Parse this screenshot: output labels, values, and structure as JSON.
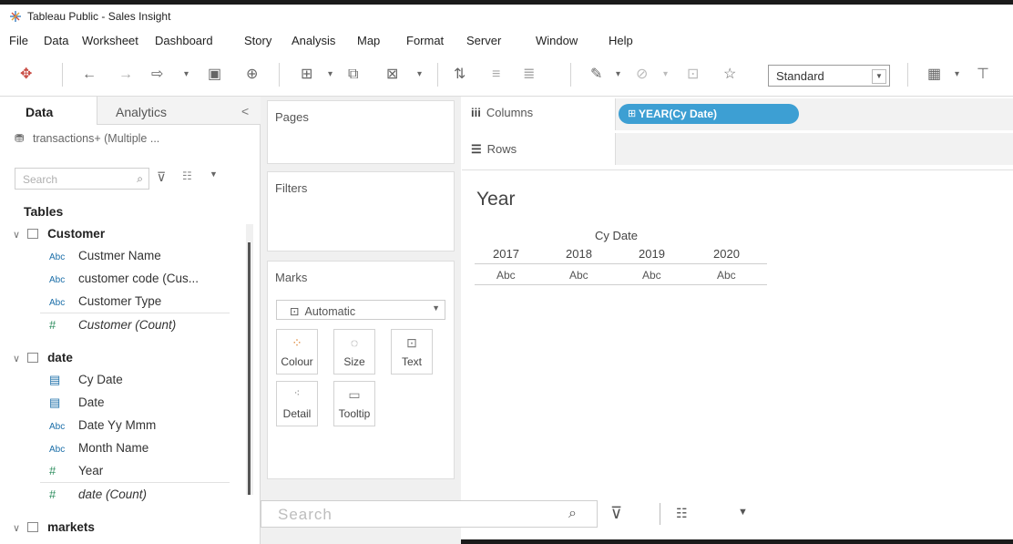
{
  "window": {
    "title": "Tableau Public - Sales Insight",
    "app_icon": "tableau-logo-icon"
  },
  "menu": [
    "File",
    "Data",
    "Worksheet",
    "Dashboard",
    "Story",
    "Analysis",
    "Map",
    "Format",
    "Server",
    "Window",
    "Help"
  ],
  "toolbar": {
    "fit_select": "Standard"
  },
  "data_pane": {
    "tab_data": "Data",
    "tab_analytics": "Analytics",
    "collapse": "<",
    "datasource": "transactions+ (Multiple ...",
    "search_placeholder": "Search",
    "tables_heading": "Tables",
    "groups": [
      {
        "name": "Customer",
        "fields": [
          {
            "type": "Abc",
            "name": "Custmer Name"
          },
          {
            "type": "Abc",
            "name": "customer code (Cus..."
          },
          {
            "type": "Abc",
            "name": "Customer Type"
          },
          {
            "type": "#",
            "name": "Customer (Count)",
            "italic": true
          }
        ]
      },
      {
        "name": "date",
        "fields": [
          {
            "type": "cal",
            "name": "Cy Date"
          },
          {
            "type": "cal",
            "name": "Date"
          },
          {
            "type": "Abc",
            "name": "Date Yy Mmm"
          },
          {
            "type": "Abc",
            "name": "Month Name"
          },
          {
            "type": "#",
            "name": "Year"
          },
          {
            "type": "#",
            "name": "date (Count)",
            "italic": true
          }
        ]
      },
      {
        "name": "markets",
        "fields": []
      }
    ]
  },
  "cards": {
    "pages": "Pages",
    "filters": "Filters",
    "marks": "Marks",
    "mark_type": "Automatic",
    "mark_buttons": [
      "Colour",
      "Size",
      "Text",
      "Detail",
      "Tooltip"
    ]
  },
  "shelves": {
    "columns_label": "Columns",
    "rows_label": "Rows",
    "columns_pill": "YEAR(Cy Date)"
  },
  "view": {
    "title": "Year",
    "header": "Cy Date",
    "years": [
      "2017",
      "2018",
      "2019",
      "2020"
    ],
    "cells": [
      "Abc",
      "Abc",
      "Abc",
      "Abc"
    ]
  },
  "float_search": {
    "placeholder": "Search"
  }
}
